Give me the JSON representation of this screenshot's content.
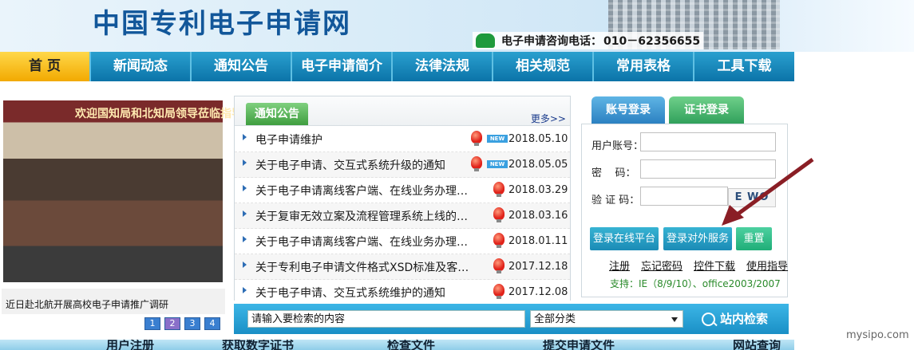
{
  "header": {
    "title": "中国专利电子申请网",
    "hotline_label": "电子申请咨询电话：",
    "hotline_number": "010－62356655"
  },
  "nav": [
    {
      "label": "首  页"
    },
    {
      "label": "新闻动态"
    },
    {
      "label": "通知公告"
    },
    {
      "label": "电子申请简介"
    },
    {
      "label": "法律法规"
    },
    {
      "label": "相关规范"
    },
    {
      "label": "常用表格"
    },
    {
      "label": "工具下载"
    }
  ],
  "slideshow": {
    "banner_text": "欢迎国知局和北知局领导莅临指导",
    "caption": "近日赴北航开展高校电子申请推广调研",
    "pages": [
      "1",
      "2",
      "3",
      "4"
    ]
  },
  "notices": {
    "tab_label": "通知公告",
    "more_label": "更多>>",
    "new_badge": "NEW",
    "items": [
      {
        "title": "电子申请维护",
        "date": "2018.05.10",
        "is_new": true
      },
      {
        "title": "关于电子申请、交互式系统升级的通知",
        "date": "2018.05.05",
        "is_new": true
      },
      {
        "title": "关于电子申请离线客户端、在线业务办理…",
        "date": "2018.03.29",
        "is_new": false
      },
      {
        "title": "关于复审无效立案及流程管理系统上线的…",
        "date": "2018.03.16",
        "is_new": false
      },
      {
        "title": "关于电子申请离线客户端、在线业务办理…",
        "date": "2018.01.11",
        "is_new": false
      },
      {
        "title": "关于专利电子申请文件格式XSD标准及客…",
        "date": "2017.12.18",
        "is_new": false
      },
      {
        "title": "关于电子申请、交互式系统维护的通知",
        "date": "2017.12.08",
        "is_new": false
      }
    ]
  },
  "login": {
    "tab_account": "账号登录",
    "tab_cert": "证书登录",
    "username_label": "用户账号：",
    "password_label": "密    码：",
    "captcha_label": "验 证 码：",
    "captcha_text": "E WO",
    "btn_online": "登录在线平台",
    "btn_external": "登录对外服务",
    "btn_reset": "重置",
    "links": [
      "注册",
      "忘记密码",
      "控件下载",
      "使用指导"
    ],
    "support": "支持：IE（8/9/10）、office2003/2007"
  },
  "search": {
    "placeholder": "请输入要检索的内容",
    "category": "全部分类",
    "button": "站内检索"
  },
  "bottom": [
    "用户注册",
    "获取数字证书",
    "检查文件",
    "提交申请文件",
    "网站查询"
  ],
  "watermark": "mysipo.com"
}
